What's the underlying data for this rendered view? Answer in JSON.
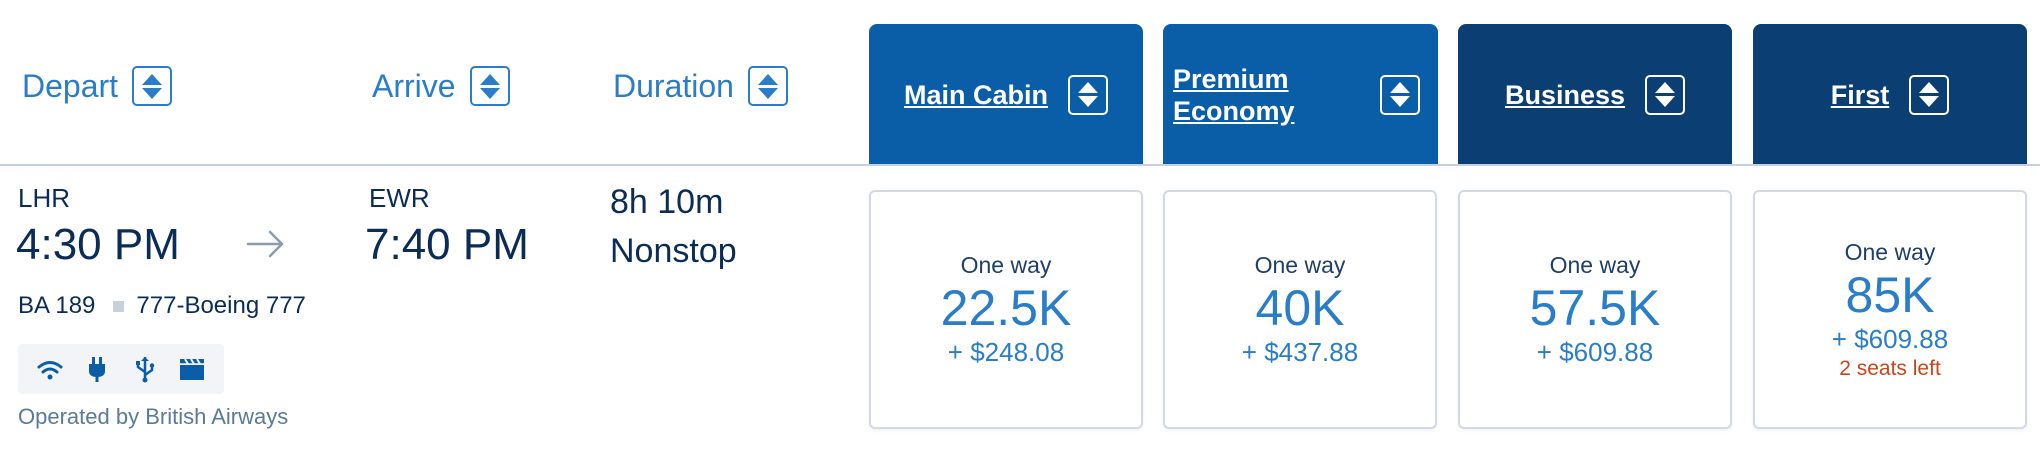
{
  "columns": {
    "depart": "Depart",
    "arrive": "Arrive",
    "duration": "Duration"
  },
  "cabins": [
    {
      "label": "Main Cabin",
      "color": "#0a5ea8"
    },
    {
      "label_line1": "Premium",
      "label_line2": "Economy",
      "color": "#0a5ea8"
    },
    {
      "label": "Business",
      "color": "#0b3f74"
    },
    {
      "label": "First",
      "color": "#0b3f74"
    }
  ],
  "flight": {
    "origin": "LHR",
    "depart_time": "4:30 PM",
    "destination": "EWR",
    "arrive_time": "7:40 PM",
    "duration": "8h 10m",
    "stops": "Nonstop",
    "flight_number": "BA 189",
    "aircraft": "777-Boeing 777",
    "amenities": [
      "wifi-icon",
      "power-plug-icon",
      "usb-icon",
      "entertainment-icon"
    ],
    "operated_by": "Operated by British Airways"
  },
  "fares": [
    {
      "label": "One way",
      "miles": "22.5K",
      "tax": "+ $248.08"
    },
    {
      "label": "One way",
      "miles": "40K",
      "tax": "+ $437.88"
    },
    {
      "label": "One way",
      "miles": "57.5K",
      "tax": "+ $609.88"
    },
    {
      "label": "One way",
      "miles": "85K",
      "tax": "+ $609.88",
      "seats_left": "2 seats left"
    }
  ],
  "colors": {
    "accent_blue": "#2a7dc8",
    "cabin_blue": "#0a5ea8",
    "cabin_navy": "#0b3f74",
    "warning": "#c7471b"
  }
}
